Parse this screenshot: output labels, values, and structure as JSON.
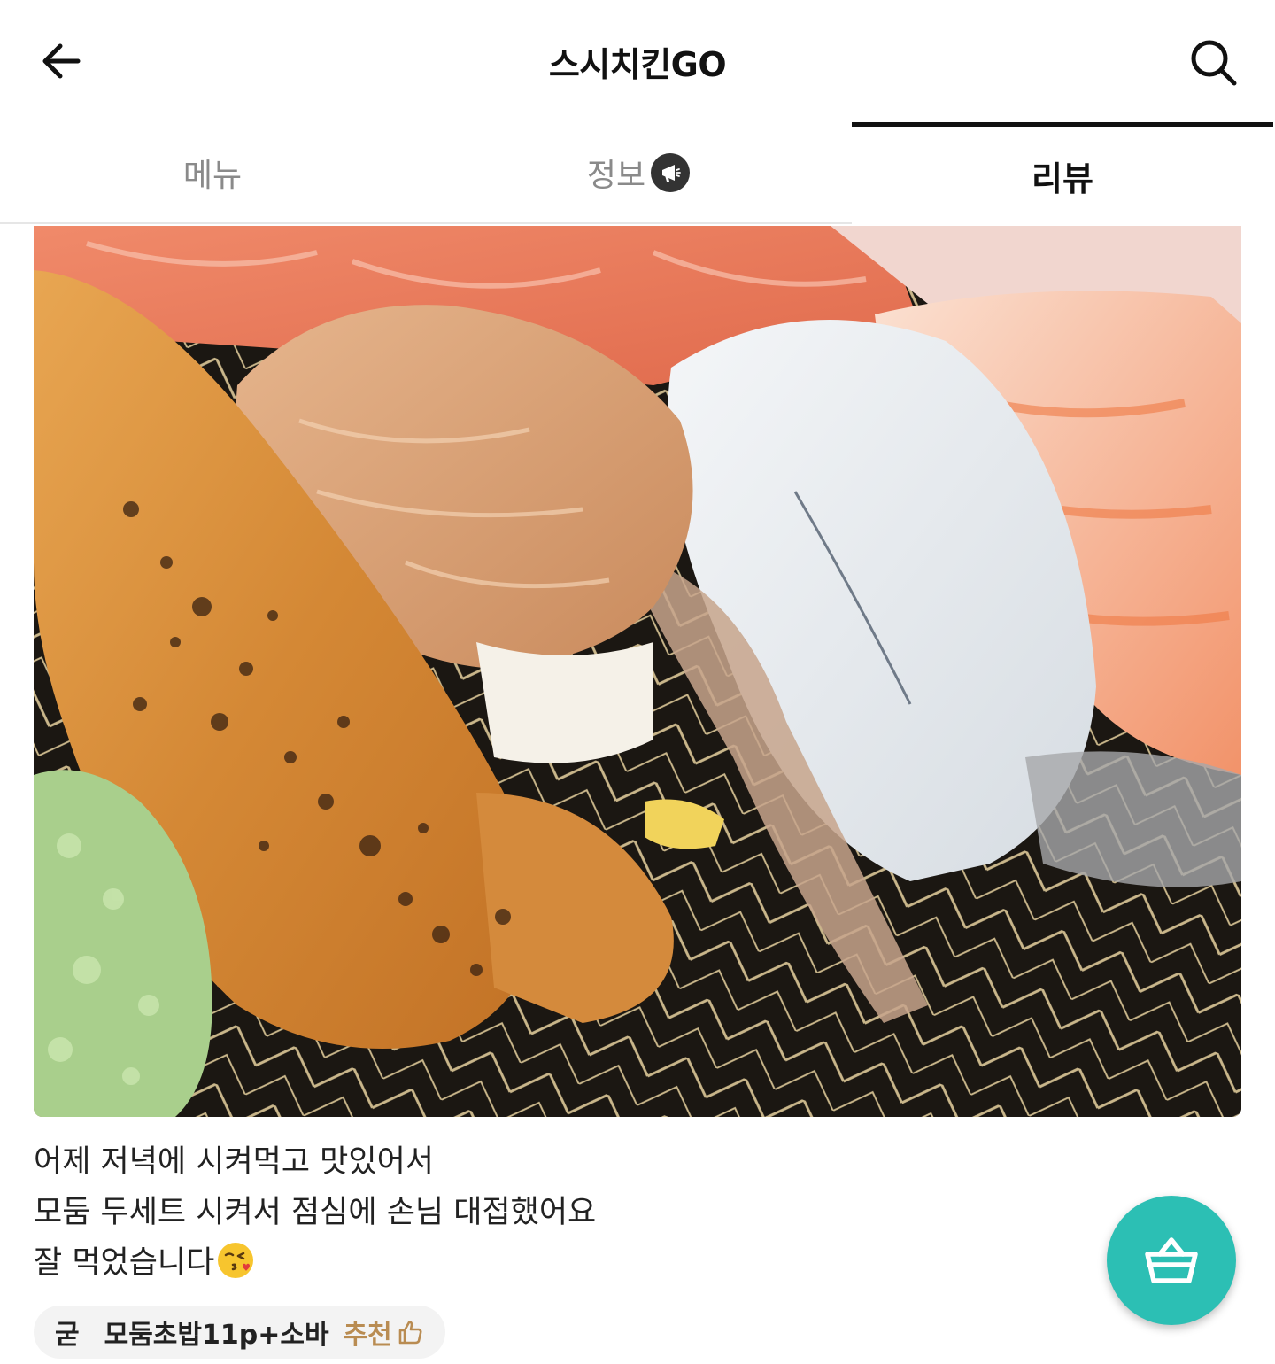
{
  "header": {
    "title": "스시치킨GO",
    "back_icon": "arrow-left-icon",
    "search_icon": "search-icon"
  },
  "tabs": [
    {
      "label": "메뉴",
      "active": false
    },
    {
      "label": "정보",
      "active": false,
      "badge_icon": "megaphone-icon"
    },
    {
      "label": "리뷰",
      "active": true
    }
  ],
  "review": {
    "photo_alt": "sushi",
    "lines": [
      "어제 저녁에 시켜먹고 맛있어서",
      "모둠 두세트 시켜서 점심에 손님 대접했어요",
      "잘 먹었습니다"
    ],
    "emoji": "😘",
    "order_qualifier": "굳",
    "order_item": "모둠초밥11p+소바",
    "recommend_label": "추천"
  },
  "cart_fab": {
    "icon": "basket-icon"
  },
  "colors": {
    "accent": "#2cbfb4",
    "recommend": "#b98c52"
  }
}
